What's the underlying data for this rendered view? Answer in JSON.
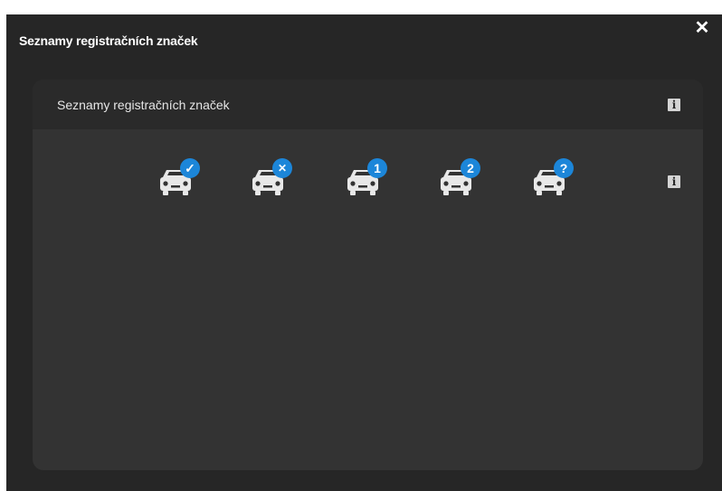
{
  "dialog": {
    "title": "Seznamy registračních značek",
    "close_symbol": "✕"
  },
  "panel": {
    "title": "Seznamy registračních značek",
    "info_symbol": "i",
    "plate_list_buttons": [
      {
        "id": "car-check",
        "badge": "✓",
        "icon": "car-check-icon"
      },
      {
        "id": "car-cross",
        "badge": "✕",
        "icon": "car-cross-icon"
      },
      {
        "id": "car-one",
        "badge": "1",
        "icon": "car-one-icon"
      },
      {
        "id": "car-two",
        "badge": "2",
        "icon": "car-two-icon"
      },
      {
        "id": "car-question",
        "badge": "?",
        "icon": "car-question-icon"
      }
    ]
  },
  "colors": {
    "dialog_bg": "#262626",
    "panel_bg": "#333333",
    "badge_blue": "#1c86d9",
    "car_grey": "#e8e8e8"
  }
}
